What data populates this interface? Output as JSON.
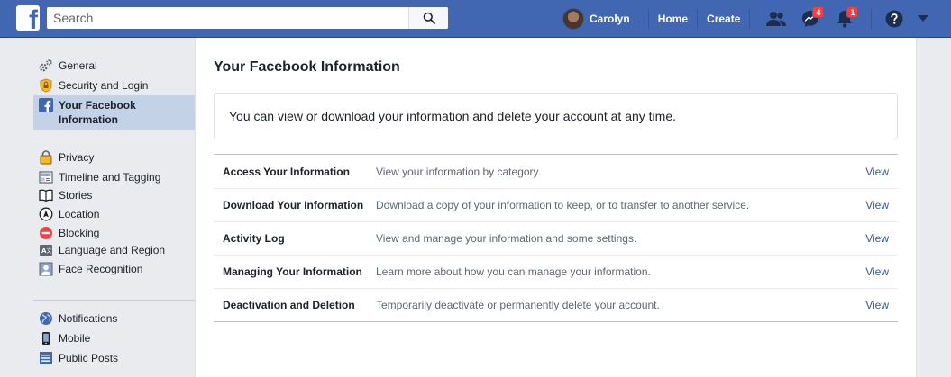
{
  "topbar": {
    "logo_letter": "f",
    "search_placeholder": "Search",
    "profile_name": "Carolyn",
    "home": "Home",
    "create": "Create",
    "messages_badge": "4",
    "notifications_badge": "1"
  },
  "sidebar": {
    "group1": [
      {
        "label": "General",
        "icon": "gear-icon"
      },
      {
        "label": "Security and Login",
        "icon": "shield-icon"
      },
      {
        "label": "Your Facebook Information",
        "icon": "facebook-icon",
        "active": true
      }
    ],
    "group2": [
      {
        "label": "Privacy",
        "icon": "lock-icon"
      },
      {
        "label": "Timeline and Tagging",
        "icon": "timeline-icon"
      },
      {
        "label": "Stories",
        "icon": "book-icon"
      },
      {
        "label": "Location",
        "icon": "location-icon"
      },
      {
        "label": "Blocking",
        "icon": "block-icon"
      },
      {
        "label": "Language and Region",
        "icon": "language-icon"
      },
      {
        "label": "Face Recognition",
        "icon": "face-icon"
      }
    ],
    "group3": [
      {
        "label": "Notifications",
        "icon": "globe-icon"
      },
      {
        "label": "Mobile",
        "icon": "mobile-icon"
      },
      {
        "label": "Public Posts",
        "icon": "rss-icon"
      }
    ]
  },
  "main": {
    "title": "Your Facebook Information",
    "info_text": "You can view or download your information and delete your account at any time.",
    "rows": [
      {
        "title": "Access Your Information",
        "desc": "View your information by category.",
        "action": "View"
      },
      {
        "title": "Download Your Information",
        "desc": "Download a copy of your information to keep, or to transfer to another service.",
        "action": "View"
      },
      {
        "title": "Activity Log",
        "desc": "View and manage your information and some settings.",
        "action": "View"
      },
      {
        "title": "Managing Your Information",
        "desc": "Learn more about how you can manage your information.",
        "action": "View"
      },
      {
        "title": "Deactivation and Deletion",
        "desc": "Temporarily deactivate or permanently delete your account.",
        "action": "View"
      }
    ]
  },
  "colors": {
    "brand": "#4267b2",
    "link": "#365899",
    "badge": "#fa3e3e",
    "active_bg": "#c4d2e7"
  }
}
